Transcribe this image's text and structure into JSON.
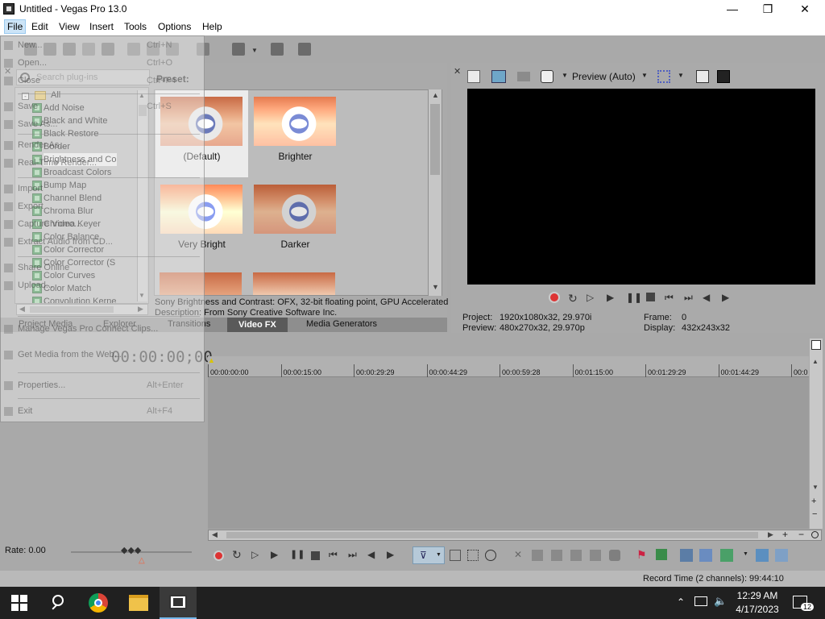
{
  "window": {
    "title": "Untitled - Vegas Pro 13.0"
  },
  "menubar": [
    "File",
    "Edit",
    "View",
    "Insert",
    "Tools",
    "Options",
    "Help"
  ],
  "file_menu": {
    "items": [
      {
        "label": "New...",
        "key": "Ctrl+N"
      },
      {
        "label": "Open...",
        "key": "Ctrl+O"
      },
      {
        "label": "Close",
        "key": "Ctrl+F4"
      },
      {
        "label": "Save",
        "key": "Ctrl+S"
      },
      {
        "label": "Save As...",
        "key": ""
      },
      {
        "label": "Render As...",
        "key": ""
      },
      {
        "label": "Real-Time Render...",
        "key": ""
      },
      {
        "label": "Import",
        "key": ""
      },
      {
        "label": "Export",
        "key": ""
      },
      {
        "label": "Capture Video...",
        "key": ""
      },
      {
        "label": "Extract Audio from CD...",
        "key": ""
      },
      {
        "label": "Share Online",
        "key": ""
      },
      {
        "label": "Upload...",
        "key": ""
      },
      {
        "label": "Manage Vegas Pro Connect Clips...",
        "key": ""
      },
      {
        "label": "Get Media from the Web...",
        "key": ""
      },
      {
        "label": "Properties...",
        "key": "Alt+Enter"
      },
      {
        "label": "Exit",
        "key": "Alt+F4"
      }
    ]
  },
  "fx_browser": {
    "search_placeholder": "Search plug-ins",
    "root": "All",
    "plugins": [
      "Add Noise",
      "Black and White",
      "Black Restore",
      "Border",
      "Brightness and Co",
      "Broadcast Colors",
      "Bump Map",
      "Channel Blend",
      "Chroma Blur",
      "Chroma Keyer",
      "Color Balance",
      "Color Corrector",
      "Color Corrector (S",
      "Color Curves",
      "Color Match",
      "Convolution Kerne"
    ],
    "selected_index": 4,
    "preset_label": "Preset:",
    "presets": [
      "(Default)",
      "Brighter",
      "Very Bright",
      "Darker"
    ],
    "description_line1": "Sony Brightness and Contrast: OFX, 32-bit floating point, GPU Accelerated",
    "description_line2": "Description: From Sony Creative Software Inc."
  },
  "panel_tabs": [
    "Project Media",
    "Explorer",
    "Transitions",
    "Video FX",
    "Media Generators"
  ],
  "active_tab": "Video FX",
  "preview": {
    "mode": "Preview (Auto)",
    "project_label": "Project:",
    "project_value": "1920x1080x32, 29.970i",
    "preview_label": "Preview:",
    "preview_value": "480x270x32, 29.970p",
    "frame_label": "Frame:",
    "frame_value": "0",
    "display_label": "Display:",
    "display_value": "432x243x32"
  },
  "timeline": {
    "timecode": "00:00:00;00",
    "ticks": [
      "00:00:00:00",
      "00:00:15:00",
      "00:00:29:29",
      "00:00:44:29",
      "00:00:59:28",
      "00:01:15:00",
      "00:01:29:29",
      "00:01:44:29",
      "00:0"
    ]
  },
  "rate": "Rate: 0.00",
  "status": {
    "record_time": "Record Time (2 channels): 99:44:10"
  },
  "taskbar": {
    "time": "12:29 AM",
    "date": "4/17/2023",
    "notif_count": "12"
  },
  "colors": {
    "accent": "#cce4f7",
    "preview_bg": "#000000",
    "taskbar": "#202020",
    "active_tab": "#5a5a5a"
  }
}
